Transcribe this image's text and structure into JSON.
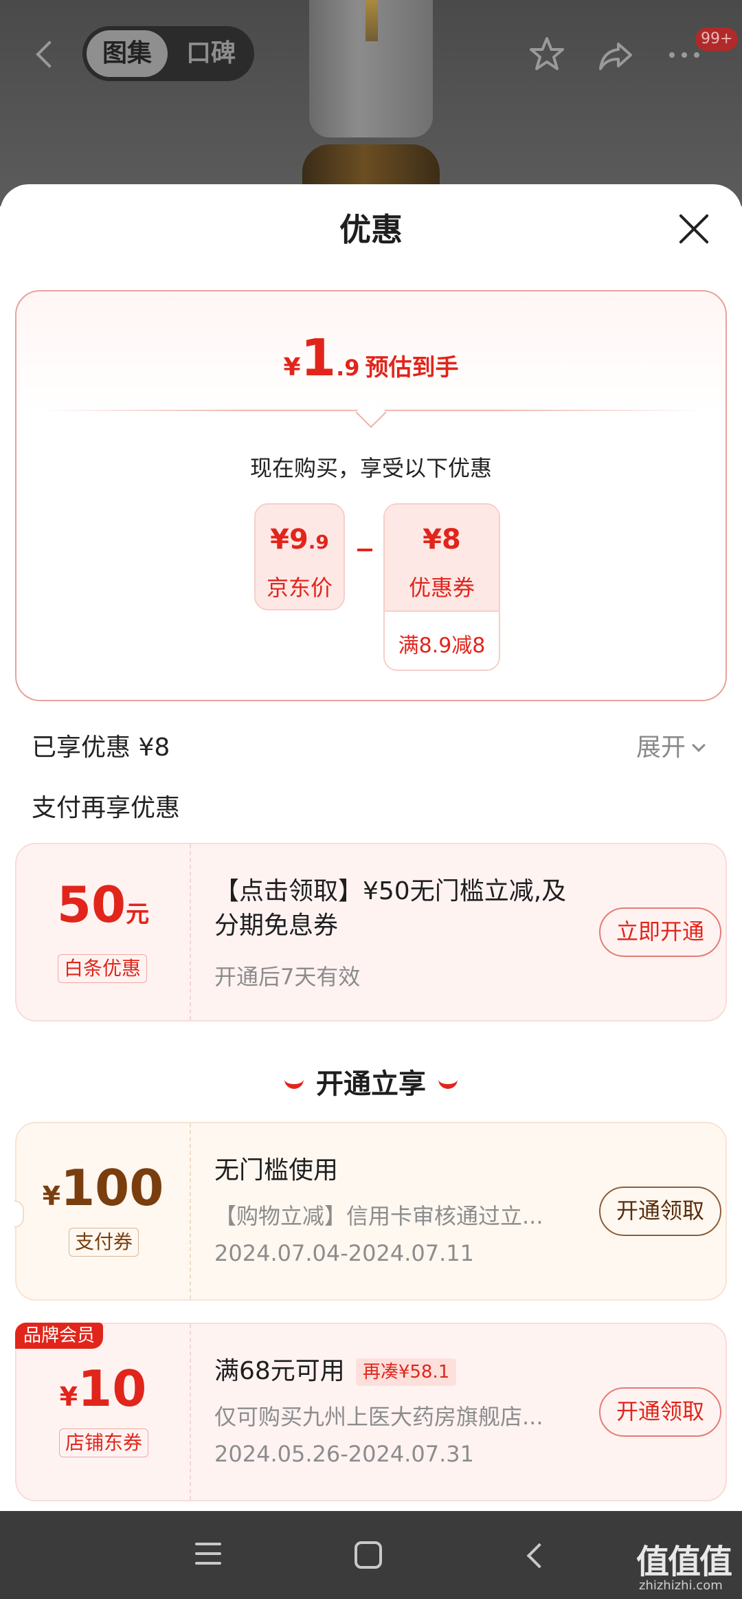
{
  "header": {
    "tabs": [
      {
        "label": "图集",
        "active": true
      },
      {
        "label": "口碑",
        "active": false
      }
    ],
    "notification_badge": "99+",
    "icons": [
      "back-icon",
      "star-icon",
      "share-icon",
      "more-icon"
    ]
  },
  "sheet": {
    "title": "优惠"
  },
  "summary": {
    "yen": "¥",
    "price_int": "1",
    "price_dec": ".9",
    "price_label": "预估到手",
    "buy_now_text": "现在购买，享受以下优惠",
    "jd_price": {
      "yen": "¥",
      "int": "9",
      "dec": ".9",
      "label": "京东价"
    },
    "coupon": {
      "yen": "¥",
      "value": "8",
      "label": "优惠券",
      "condition": "满8.9减8"
    }
  },
  "enjoyed": {
    "text": "已享优惠 ¥8",
    "expand_label": "展开"
  },
  "pay_more_title": "支付再享优惠",
  "baitiao_coupon": {
    "amount": "50",
    "unit": "元",
    "tag": "白条优惠",
    "title": "【点击领取】¥50无门槛立减,及分期免息券",
    "desc": "开通后7天有效",
    "button": "立即开通"
  },
  "open_header": "开通立享",
  "pay_coupon": {
    "yen": "¥",
    "amount": "100",
    "tag": "支付券",
    "title": "无门槛使用",
    "desc": "【购物立减】信用卡审核通过立...",
    "date": "2024.07.04-2024.07.11",
    "button": "开通领取"
  },
  "shop_coupon": {
    "brand_tag": "品牌会员",
    "yen": "¥",
    "amount": "10",
    "tag": "店铺东券",
    "title": "满68元可用",
    "mini_badge": "再凑¥58.1",
    "desc": "仅可购买九州上医大药房旗舰店...",
    "date": "2024.05.26-2024.07.31",
    "button": "开通领取"
  },
  "watermark": {
    "text": "值值值",
    "sub": "zhizhizhi.com"
  },
  "colors": {
    "accent": "#e1251b",
    "gold": "#7a3e0e",
    "nav_bg": "#3b3b3b"
  }
}
